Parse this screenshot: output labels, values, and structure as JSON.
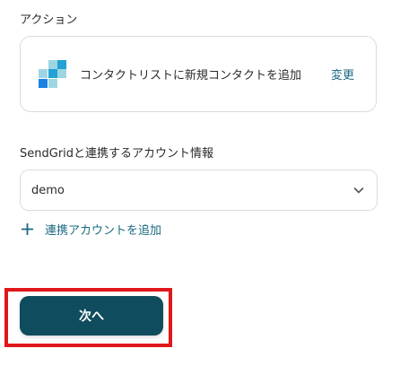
{
  "action_section": {
    "label": "アクション",
    "card": {
      "app_logo_icon": "sendgrid-logo-icon",
      "action_text": "コンタクトリストに新規コンタクトを追加",
      "change_label": "変更"
    }
  },
  "account_section": {
    "label": "SendGridと連携するアカウント情報",
    "select": {
      "value": "demo",
      "chevron_icon": "chevron-down-icon"
    },
    "add_account": {
      "icon": "plus-icon",
      "label": "連携アカウントを追加"
    }
  },
  "footer": {
    "next_label": "次へ"
  },
  "colors": {
    "accent": "#1a6a82",
    "primary_button": "#0f4c5e",
    "highlight": "#e0171b",
    "sendgrid_light": "#9dd6e3",
    "sendgrid_mid": "#22a1d6",
    "sendgrid_dark": "#1a82e2"
  }
}
